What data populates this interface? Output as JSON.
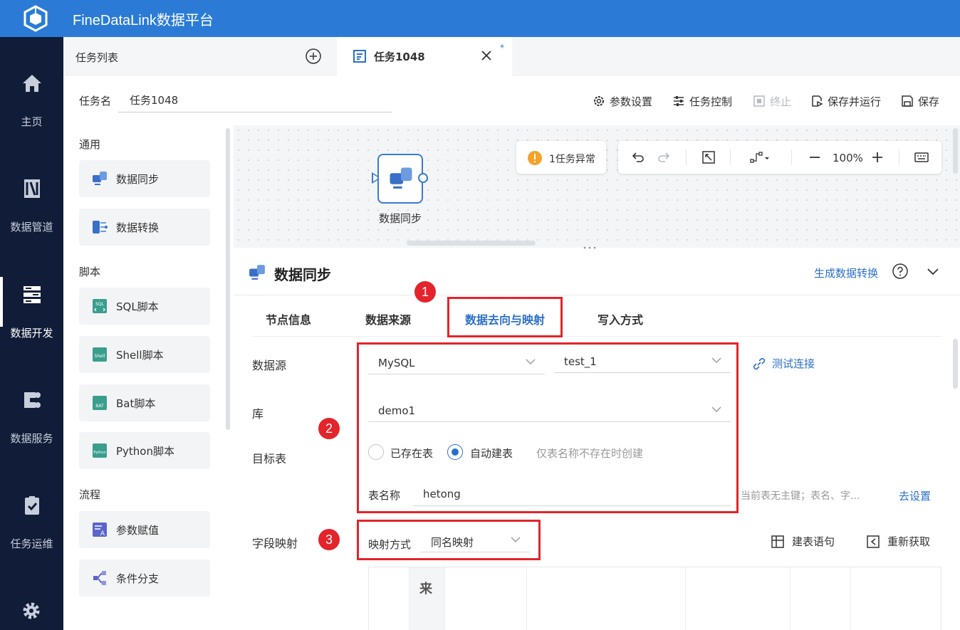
{
  "app": {
    "title": "FineDataLink数据平台"
  },
  "nav": {
    "items": [
      {
        "label": "主页",
        "icon": "home-icon"
      },
      {
        "label": "数据管道",
        "icon": "pipeline-icon"
      },
      {
        "label": "数据开发",
        "icon": "dev-icon",
        "active": true
      },
      {
        "label": "数据服务",
        "icon": "service-icon"
      },
      {
        "label": "任务运维",
        "icon": "ops-icon"
      }
    ]
  },
  "tabs": {
    "list_label": "任务列表",
    "active_label": "任务1048",
    "modified_mark": "*"
  },
  "header": {
    "taskname_label": "任务名",
    "taskname_value": "任务1048",
    "tools": {
      "params": "参数设置",
      "control": "任务控制",
      "stop": "终止",
      "save_run": "保存并运行",
      "save": "保存"
    }
  },
  "components": {
    "groups": [
      {
        "title": "通用",
        "items": [
          "数据同步",
          "数据转换"
        ]
      },
      {
        "title": "脚本",
        "items": [
          "SQL脚本",
          "Shell脚本",
          "Bat脚本",
          "Python脚本"
        ]
      },
      {
        "title": "流程",
        "items": [
          "参数赋值",
          "条件分支"
        ]
      }
    ]
  },
  "canvas": {
    "node_label": "数据同步",
    "warning_text": "1任务异常",
    "zoom": "100%"
  },
  "config": {
    "title": "数据同步",
    "gen_link": "生成数据转换",
    "subtabs": [
      "节点信息",
      "数据来源",
      "数据去向与映射",
      "写入方式"
    ],
    "active_subtab": 2,
    "datasource_label": "数据源",
    "datasource_type": "MySQL",
    "datasource_conn": "test_1",
    "test_conn": "测试连接",
    "db_label": "库",
    "db_value": "demo1",
    "target_label": "目标表",
    "radio_existing": "已存在表",
    "radio_auto": "自动建表",
    "radio_selected": "auto",
    "hint": "仅表名称不存在时创建",
    "tablename_label": "表名称",
    "tablename_value": "hetong",
    "pk_note": "当前表无主键；表名、字...",
    "go_setting": "去设置",
    "field_map_label": "字段映射",
    "map_mode_label": "映射方式",
    "map_mode_value": "同名映射",
    "build_sql": "建表语句",
    "refetch": "重新获取",
    "table_head_partial": "来"
  },
  "annotations": [
    "1",
    "2",
    "3"
  ],
  "colors": {
    "brand": "#2b7bd6",
    "nav_bg": "#111c38",
    "link": "#2b6fcb",
    "annotation": "#e3242b",
    "warning": "#f3a32c"
  }
}
